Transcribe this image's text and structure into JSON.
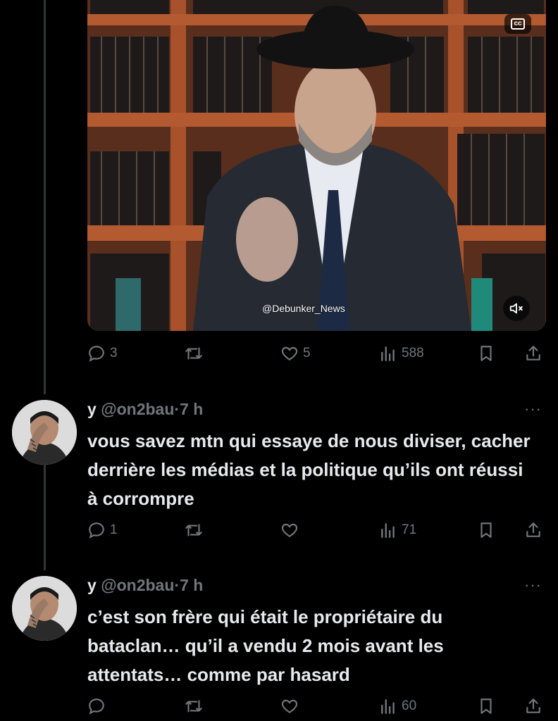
{
  "video": {
    "watermark": "@Debunker_News",
    "cc_label": "cc",
    "actions": {
      "replies": "3",
      "retweets": "",
      "likes": "5",
      "views": "588"
    }
  },
  "replies": [
    {
      "name": "y",
      "handle": "@on2bau",
      "separator": "·",
      "time": "7 h",
      "more": "···",
      "text": "vous savez mtn qui essaye de nous diviser, cacher derrière les médias et la politique qu’ils ont réussi à corrompre",
      "actions": {
        "replies": "1",
        "retweets": "",
        "likes": "",
        "views": "71"
      }
    },
    {
      "name": "y",
      "handle": "@on2bau",
      "separator": "·",
      "time": "7 h",
      "more": "···",
      "text": "c’est son frère qui était le propriétaire du bataclan… qu’il a vendu 2 mois avant les attentats… comme par hasard",
      "actions": {
        "replies": "",
        "retweets": "",
        "likes": "",
        "views": "60"
      }
    }
  ],
  "colors": {
    "background": "#000000",
    "text": "#e7e9ea",
    "muted": "#71767b",
    "divider": "#333639"
  },
  "icons": [
    "reply-icon",
    "retweet-icon",
    "like-icon",
    "views-icon",
    "bookmark-icon",
    "share-icon",
    "cc-icon",
    "mute-icon",
    "more-icon"
  ]
}
